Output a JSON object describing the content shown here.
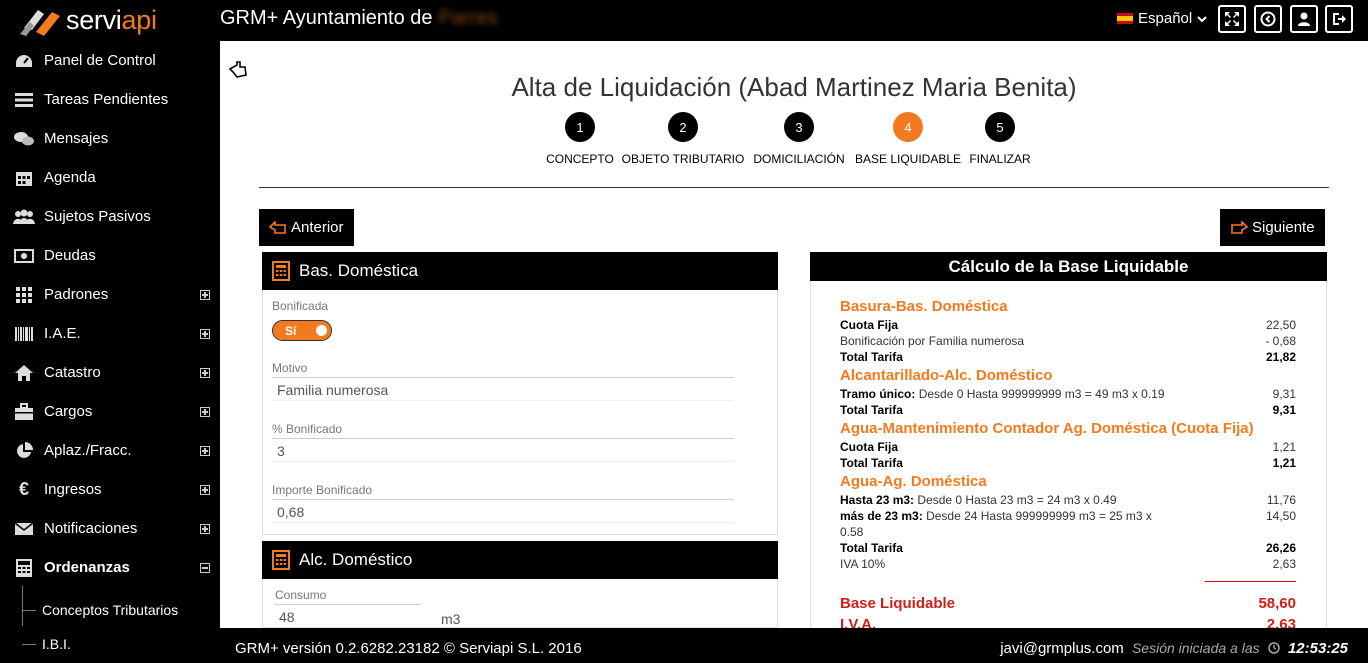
{
  "header": {
    "logo_text_a": "servi",
    "logo_text_b": "api",
    "title": "GRM+ Ayuntamiento de",
    "title_blurred": "Parres",
    "language": "Español"
  },
  "sidebar": {
    "items": [
      {
        "label": "Panel de Control",
        "icon": "dashboard-icon"
      },
      {
        "label": "Tareas Pendientes",
        "icon": "tasks-icon"
      },
      {
        "label": "Mensajes",
        "icon": "messages-icon"
      },
      {
        "label": "Agenda",
        "icon": "calendar-icon"
      },
      {
        "label": "Sujetos Pasivos",
        "icon": "users-icon"
      },
      {
        "label": "Deudas",
        "icon": "money-icon"
      },
      {
        "label": "Padrones",
        "icon": "grid-icon"
      },
      {
        "label": "I.A.E.",
        "icon": "barcode-icon"
      },
      {
        "label": "Catastro",
        "icon": "home-icon"
      },
      {
        "label": "Cargos",
        "icon": "briefcase-icon"
      },
      {
        "label": "Aplaz./Fracc.",
        "icon": "pie-icon"
      },
      {
        "label": "Ingresos",
        "icon": "euro-icon"
      },
      {
        "label": "Notificaciones",
        "icon": "envelope-icon"
      },
      {
        "label": "Ordenanzas",
        "icon": "calculator-icon"
      }
    ],
    "sub_items": [
      "Conceptos Tributarios",
      "I.B.I."
    ]
  },
  "page": {
    "title": "Alta de Liquidación (Abad Martinez Maria Benita)",
    "steps": [
      {
        "num": "1",
        "label": "CONCEPTO"
      },
      {
        "num": "2",
        "label": "OBJETO TRIBUTARIO"
      },
      {
        "num": "3",
        "label": "DOMICILIACIÓN"
      },
      {
        "num": "4",
        "label": "BASE LIQUIDABLE"
      },
      {
        "num": "5",
        "label": "FINALIZAR"
      }
    ],
    "btn_prev": "Anterior",
    "btn_next": "Siguiente"
  },
  "bas_domestica": {
    "title": "Bas. Doméstica",
    "bonificada_label": "Bonificada",
    "bonificada_value": "Sí",
    "motivo_label": "Motivo",
    "motivo_value": "Familia numerosa",
    "pct_label": "% Bonificado",
    "pct_value": "3",
    "importe_label": "Importe Bonificado",
    "importe_value": "0,68"
  },
  "alc_domestico": {
    "title": "Alc. Doméstico",
    "consumo_label": "Consumo",
    "consumo_value": "48",
    "unit": "m3"
  },
  "calculo": {
    "title": "Cálculo de la Base Liquidable",
    "s1": {
      "title": "Basura-Bas. Doméstica",
      "r1_label": "Cuota Fija",
      "r1_value": "22,50",
      "r2_label": "Bonificación por Familia numerosa",
      "r2_value": "- 0,68",
      "total_label": "Total Tarifa",
      "total_value": "21,82"
    },
    "s2": {
      "title": "Alcantarillado-Alc. Doméstico",
      "r1_bold": "Tramo único:",
      "r1_label": "Desde 0 Hasta 999999999 m3 = 49 m3 x 0.19",
      "r1_value": "9,31",
      "total_label": "Total Tarifa",
      "total_value": "9,31"
    },
    "s3": {
      "title": "Agua-Mantenimiento Contador Ag. Doméstica (Cuota Fija)",
      "r1_label": "Cuota Fija",
      "r1_value": "1,21",
      "total_label": "Total Tarifa",
      "total_value": "1,21"
    },
    "s4": {
      "title": "Agua-Ag. Doméstica",
      "r1_bold": "Hasta 23 m3:",
      "r1_label": "Desde 0 Hasta 23 m3 = 24 m3 x 0.49",
      "r1_value": "11,76",
      "r2_bold": "más de 23 m3:",
      "r2_label": "Desde 24 Hasta 999999999 m3 = 25 m3 x",
      "r2_label_wrap": "0.58",
      "r2_value": "14,50",
      "total_label": "Total Tarifa",
      "total_value": "26,26",
      "iva_label": "IVA 10%",
      "iva_value": "2,63"
    },
    "base_label": "Base Liquidable",
    "base_value": "58,60",
    "iva_label": "I.V.A.",
    "iva_value": "2,63"
  },
  "footer": {
    "version": "GRM+ versión 0.2.6282.23182 © Serviapi S.L. 2016",
    "user": "javi@grmplus.com",
    "session": "Sesión iniciada a las",
    "time": "12:53:25"
  }
}
